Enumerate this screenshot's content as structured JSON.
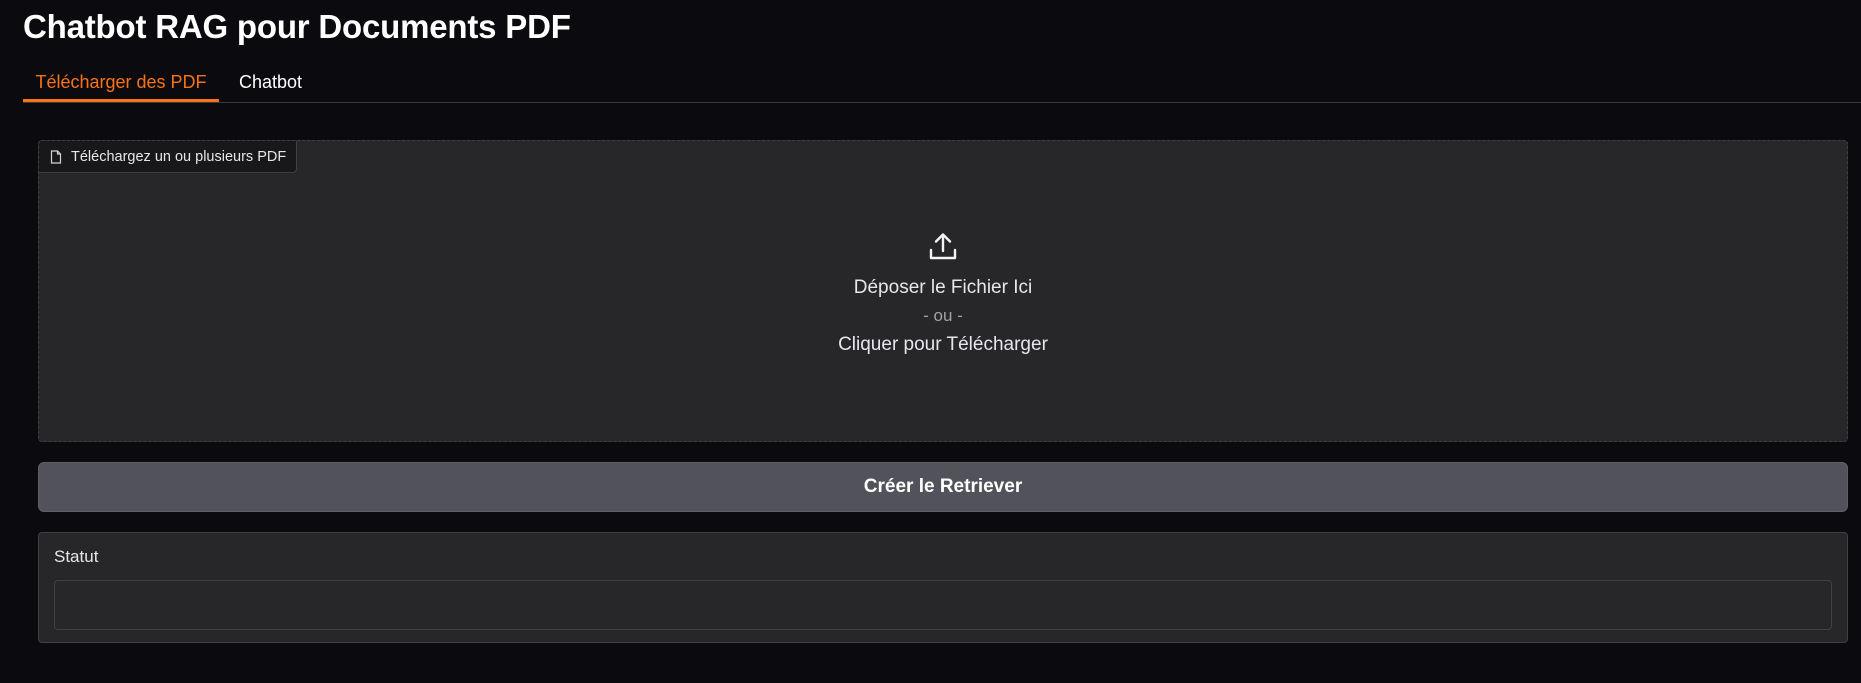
{
  "app": {
    "title": "Chatbot RAG pour Documents PDF"
  },
  "tabs": [
    {
      "label": "Télécharger des PDF",
      "active": true
    },
    {
      "label": "Chatbot",
      "active": false
    }
  ],
  "upload": {
    "label": "Téléchargez un ou plusieurs PDF",
    "label_icon": "file-icon",
    "icon": "upload-icon",
    "drop_text": "Déposer le Fichier Ici",
    "or_text": "- ou -",
    "click_text": "Cliquer pour Télécharger"
  },
  "actions": {
    "create_button_label": "Créer le Retriever"
  },
  "status": {
    "label": "Statut",
    "value": ""
  },
  "colors": {
    "background": "#0b0b0f",
    "panel": "#27272a",
    "accent": "#f97316",
    "button": "#52525b",
    "border": "#3f3f46"
  }
}
